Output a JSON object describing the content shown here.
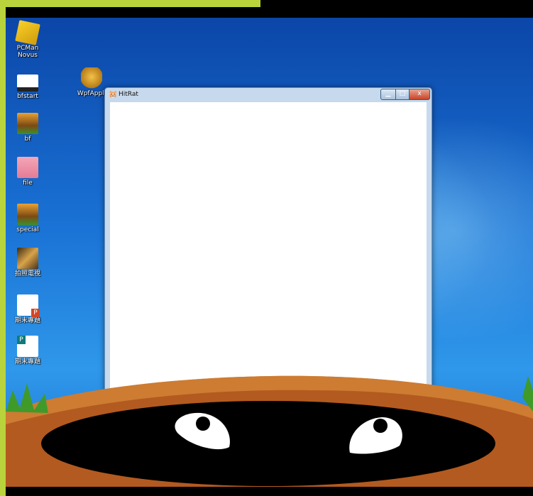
{
  "desktop": {
    "icons": [
      {
        "label": "PCMan\nNovus",
        "icon": "pcman-novus-icon"
      },
      {
        "label": "bfstart",
        "icon": "bfstart-icon"
      },
      {
        "label": "bf",
        "icon": "bf-icon"
      },
      {
        "label": "file",
        "icon": "file-icon"
      },
      {
        "label": "special",
        "icon": "special-icon"
      },
      {
        "label": "拍照電視",
        "icon": "photo-app-icon"
      },
      {
        "label": "期末專題",
        "icon": "powerpoint-file-icon"
      },
      {
        "label": "期末專題",
        "icon": "publisher-file-icon"
      },
      {
        "label": "WpfAppli",
        "icon": "wpf-app-icon"
      }
    ]
  },
  "window": {
    "title": "HitRat",
    "minimize_symbol": "▁",
    "maximize_symbol": "□",
    "close_symbol": "x"
  },
  "colors": {
    "frame_green": "#b9d33c",
    "desktop_blue": "#1a73d6",
    "dirt": "#b35a20",
    "hole": "#000000",
    "grass": "#3f9a2a"
  }
}
